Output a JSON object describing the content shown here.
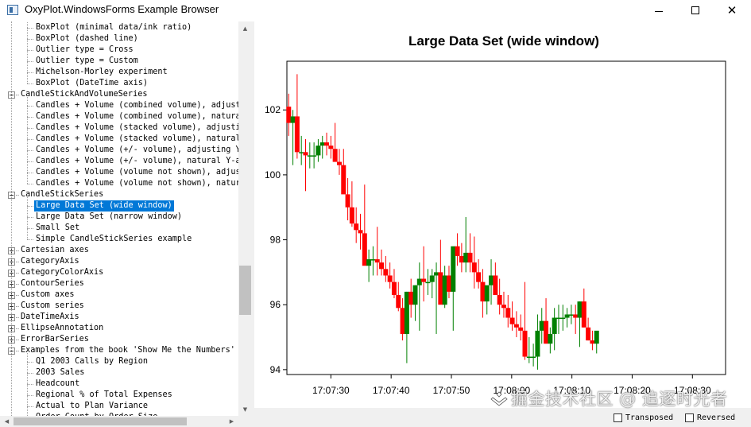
{
  "window": {
    "title": "OxyPlot.WindowsForms Example Browser",
    "minimize_glyph": "",
    "maximize_glyph": "",
    "close_glyph": "✕"
  },
  "tree": {
    "items": [
      {
        "label": "BoxPlot (minimal data/ink ratio)",
        "level": 1,
        "type": "leaf"
      },
      {
        "label": "BoxPlot (dashed line)",
        "level": 1,
        "type": "leaf"
      },
      {
        "label": "Outlier type = Cross",
        "level": 1,
        "type": "leaf"
      },
      {
        "label": "Outlier type = Custom",
        "level": 1,
        "type": "leaf"
      },
      {
        "label": "Michelson-Morley experiment",
        "level": 1,
        "type": "leaf"
      },
      {
        "label": "BoxPlot (DateTime axis)",
        "level": 1,
        "type": "leaf"
      },
      {
        "label": "CandleStickAndVolumeSeries",
        "level": 0,
        "type": "expanded"
      },
      {
        "label": "Candles + Volume (combined volume), adjusting",
        "level": 1,
        "type": "leaf"
      },
      {
        "label": "Candles + Volume (combined volume), natural Y-",
        "level": 1,
        "type": "leaf"
      },
      {
        "label": "Candles + Volume (stacked volume), adjusting Y",
        "level": 1,
        "type": "leaf"
      },
      {
        "label": "Candles + Volume (stacked volume), natural Y-a",
        "level": 1,
        "type": "leaf"
      },
      {
        "label": "Candles + Volume (+/- volume), adjusting Y-axi",
        "level": 1,
        "type": "leaf"
      },
      {
        "label": "Candles + Volume (+/- volume), natural Y-axis",
        "level": 1,
        "type": "leaf"
      },
      {
        "label": "Candles + Volume (volume not shown), adjusting",
        "level": 1,
        "type": "leaf"
      },
      {
        "label": "Candles + Volume (volume not shown), natural Y",
        "level": 1,
        "type": "leaf"
      },
      {
        "label": "CandleStickSeries",
        "level": 0,
        "type": "expanded"
      },
      {
        "label": "Large Data Set (wide window)",
        "level": 1,
        "type": "leaf",
        "selected": true
      },
      {
        "label": "Large Data Set (narrow window)",
        "level": 1,
        "type": "leaf"
      },
      {
        "label": "Small Set",
        "level": 1,
        "type": "leaf"
      },
      {
        "label": "Simple CandleStickSeries example",
        "level": 1,
        "type": "leaf"
      },
      {
        "label": "Cartesian axes",
        "level": 0,
        "type": "collapsed"
      },
      {
        "label": "CategoryAxis",
        "level": 0,
        "type": "collapsed"
      },
      {
        "label": "CategoryColorAxis",
        "level": 0,
        "type": "collapsed"
      },
      {
        "label": "ContourSeries",
        "level": 0,
        "type": "collapsed"
      },
      {
        "label": "Custom axes",
        "level": 0,
        "type": "collapsed"
      },
      {
        "label": "Custom series",
        "level": 0,
        "type": "collapsed"
      },
      {
        "label": "DateTimeAxis",
        "level": 0,
        "type": "collapsed"
      },
      {
        "label": "EllipseAnnotation",
        "level": 0,
        "type": "collapsed"
      },
      {
        "label": "ErrorBarSeries",
        "level": 0,
        "type": "collapsed"
      },
      {
        "label": "Examples from the book 'Show Me the Numbers'",
        "level": 0,
        "type": "expanded"
      },
      {
        "label": "Q1 2003 Calls by Region",
        "level": 1,
        "type": "leaf"
      },
      {
        "label": "2003 Sales",
        "level": 1,
        "type": "leaf"
      },
      {
        "label": "Headcount",
        "level": 1,
        "type": "leaf"
      },
      {
        "label": "Regional % of Total Expenses",
        "level": 1,
        "type": "leaf"
      },
      {
        "label": "Actual to Plan Variance",
        "level": 1,
        "type": "leaf"
      },
      {
        "label": "Order Count by Order Size",
        "level": 1,
        "type": "leaf"
      }
    ]
  },
  "options": {
    "transposed_label": "Transposed",
    "reversed_label": "Reversed",
    "transposed_checked": false,
    "reversed_checked": false
  },
  "watermark": {
    "text": "掘金技术社区 @ 追逐时光者"
  },
  "colors": {
    "increasing": "#008000",
    "decreasing": "#ff0000",
    "selection": "#0078d7"
  },
  "chart_data": {
    "type": "candlestick",
    "title": "Large Data Set (wide window)",
    "xlabel": "",
    "ylabel": "",
    "ylim": [
      93.85,
      103.5
    ],
    "xlim": [
      "17:07:22.7",
      "17:08:35.5"
    ],
    "y_ticks": [
      94,
      96,
      98,
      100,
      102
    ],
    "y_tick_labels": [
      "94",
      "96",
      "98",
      "100",
      "102"
    ],
    "x_ticks": [
      "17:07:30",
      "17:07:40",
      "17:07:50",
      "17:08:00",
      "17:08:10",
      "17:08:20",
      "17:08:30"
    ],
    "x_tick_labels": [
      "17:07:30",
      "17:07:40",
      "17:07:50",
      "17:08:00",
      "17:08:10",
      "17:08:20",
      "17:08:30"
    ],
    "grid": false,
    "legend": "none",
    "candles": [
      {
        "t": "17:07:23.0",
        "open": 102.1,
        "high": 102.5,
        "low": 101.2,
        "close": 101.6
      },
      {
        "t": "17:07:23.7",
        "open": 101.6,
        "high": 102.0,
        "low": 100.3,
        "close": 101.8
      },
      {
        "t": "17:07:24.4",
        "open": 101.8,
        "high": 103.1,
        "low": 100.5,
        "close": 100.7
      },
      {
        "t": "17:07:25.1",
        "open": 100.7,
        "high": 101.2,
        "low": 100.3,
        "close": 100.7
      },
      {
        "t": "17:07:25.8",
        "open": 100.7,
        "high": 101.1,
        "low": 99.5,
        "close": 100.6
      },
      {
        "t": "17:07:26.5",
        "open": 100.6,
        "high": 101.0,
        "low": 100.2,
        "close": 100.6
      },
      {
        "t": "17:07:27.2",
        "open": 100.6,
        "high": 101.0,
        "low": 100.2,
        "close": 100.6
      },
      {
        "t": "17:07:27.9",
        "open": 100.6,
        "high": 101.1,
        "low": 100.4,
        "close": 100.9
      },
      {
        "t": "17:07:28.6",
        "open": 100.9,
        "high": 101.2,
        "low": 100.5,
        "close": 101.0
      },
      {
        "t": "17:07:29.3",
        "open": 101.0,
        "high": 101.3,
        "low": 100.6,
        "close": 100.9
      },
      {
        "t": "17:07:30.0",
        "open": 100.9,
        "high": 101.2,
        "low": 100.5,
        "close": 100.8
      },
      {
        "t": "17:07:30.7",
        "open": 100.8,
        "high": 101.6,
        "low": 100.4,
        "close": 100.4
      },
      {
        "t": "17:07:31.4",
        "open": 100.4,
        "high": 100.8,
        "low": 100.0,
        "close": 100.3
      },
      {
        "t": "17:07:32.1",
        "open": 100.3,
        "high": 100.8,
        "low": 99.6,
        "close": 99.4
      },
      {
        "t": "17:07:32.8",
        "open": 99.4,
        "high": 99.9,
        "low": 98.6,
        "close": 99.0
      },
      {
        "t": "17:07:33.5",
        "open": 99.0,
        "high": 99.8,
        "low": 98.4,
        "close": 98.5
      },
      {
        "t": "17:07:34.2",
        "open": 98.5,
        "high": 99.0,
        "low": 97.9,
        "close": 98.3
      },
      {
        "t": "17:07:34.9",
        "open": 98.3,
        "high": 98.8,
        "low": 97.7,
        "close": 98.2
      },
      {
        "t": "17:07:35.6",
        "open": 98.2,
        "high": 99.7,
        "low": 97.4,
        "close": 97.2
      },
      {
        "t": "17:07:36.3",
        "open": 97.2,
        "high": 97.7,
        "low": 96.7,
        "close": 97.4
      },
      {
        "t": "17:07:37.0",
        "open": 97.4,
        "high": 97.8,
        "low": 96.9,
        "close": 97.4
      },
      {
        "t": "17:07:37.7",
        "open": 97.4,
        "high": 98.4,
        "low": 96.9,
        "close": 97.3
      },
      {
        "t": "17:07:38.4",
        "open": 97.3,
        "high": 97.7,
        "low": 96.9,
        "close": 97.1
      },
      {
        "t": "17:07:39.1",
        "open": 97.1,
        "high": 97.5,
        "low": 96.7,
        "close": 96.9
      },
      {
        "t": "17:07:39.8",
        "open": 96.9,
        "high": 97.3,
        "low": 96.5,
        "close": 96.7
      },
      {
        "t": "17:07:40.5",
        "open": 96.7,
        "high": 97.1,
        "low": 96.2,
        "close": 96.3
      },
      {
        "t": "17:07:41.2",
        "open": 96.3,
        "high": 96.7,
        "low": 95.8,
        "close": 95.9
      },
      {
        "t": "17:07:41.9",
        "open": 95.9,
        "high": 96.2,
        "low": 94.9,
        "close": 95.1
      },
      {
        "t": "17:07:42.6",
        "open": 95.1,
        "high": 96.4,
        "low": 94.2,
        "close": 96.4
      },
      {
        "t": "17:07:43.3",
        "open": 96.4,
        "high": 96.8,
        "low": 95.6,
        "close": 96.0
      },
      {
        "t": "17:07:44.0",
        "open": 96.0,
        "high": 96.6,
        "low": 95.5,
        "close": 96.6
      },
      {
        "t": "17:07:44.7",
        "open": 96.6,
        "high": 97.3,
        "low": 95.2,
        "close": 96.8
      },
      {
        "t": "17:07:45.4",
        "open": 96.8,
        "high": 97.8,
        "low": 96.1,
        "close": 96.7
      },
      {
        "t": "17:07:46.1",
        "open": 96.7,
        "high": 97.1,
        "low": 96.3,
        "close": 96.7
      },
      {
        "t": "17:07:46.8",
        "open": 96.7,
        "high": 97.1,
        "low": 96.2,
        "close": 96.9
      },
      {
        "t": "17:07:47.5",
        "open": 96.9,
        "high": 97.3,
        "low": 95.1,
        "close": 97.0
      },
      {
        "t": "17:07:48.2",
        "open": 97.0,
        "high": 98.0,
        "low": 96.6,
        "close": 96.0
      },
      {
        "t": "17:07:48.9",
        "open": 96.0,
        "high": 97.2,
        "low": 95.9,
        "close": 96.9
      },
      {
        "t": "17:07:49.6",
        "open": 96.9,
        "high": 97.2,
        "low": 96.2,
        "close": 96.4
      },
      {
        "t": "17:07:50.3",
        "open": 96.4,
        "high": 96.8,
        "low": 95.2,
        "close": 97.8
      },
      {
        "t": "17:07:51.0",
        "open": 97.8,
        "high": 98.2,
        "low": 97.2,
        "close": 97.5
      },
      {
        "t": "17:07:51.7",
        "open": 97.5,
        "high": 97.9,
        "low": 97.0,
        "close": 97.3
      },
      {
        "t": "17:07:52.4",
        "open": 97.3,
        "high": 98.7,
        "low": 97.0,
        "close": 97.6
      },
      {
        "t": "17:07:53.1",
        "open": 97.6,
        "high": 98.2,
        "low": 97.0,
        "close": 97.3
      },
      {
        "t": "17:07:53.8",
        "open": 97.3,
        "high": 98.1,
        "low": 96.5,
        "close": 97.0
      },
      {
        "t": "17:07:54.5",
        "open": 97.0,
        "high": 97.4,
        "low": 96.5,
        "close": 96.7
      },
      {
        "t": "17:07:55.2",
        "open": 96.7,
        "high": 97.1,
        "low": 95.6,
        "close": 96.1
      },
      {
        "t": "17:07:55.9",
        "open": 96.1,
        "high": 96.5,
        "low": 95.7,
        "close": 96.6
      },
      {
        "t": "17:07:56.6",
        "open": 96.6,
        "high": 97.4,
        "low": 96.0,
        "close": 96.9
      },
      {
        "t": "17:07:57.3",
        "open": 96.9,
        "high": 97.3,
        "low": 96.4,
        "close": 96.3
      },
      {
        "t": "17:07:58.0",
        "open": 96.3,
        "high": 96.8,
        "low": 95.7,
        "close": 96.0
      },
      {
        "t": "17:07:58.7",
        "open": 96.0,
        "high": 96.4,
        "low": 95.6,
        "close": 95.9
      },
      {
        "t": "17:07:59.4",
        "open": 95.9,
        "high": 96.3,
        "low": 95.3,
        "close": 95.6
      },
      {
        "t": "17:08:00.1",
        "open": 95.6,
        "high": 96.1,
        "low": 95.2,
        "close": 95.4
      },
      {
        "t": "17:08:00.8",
        "open": 95.4,
        "high": 95.8,
        "low": 95.0,
        "close": 95.3
      },
      {
        "t": "17:08:01.5",
        "open": 95.3,
        "high": 95.7,
        "low": 94.9,
        "close": 95.2
      },
      {
        "t": "17:08:02.2",
        "open": 95.2,
        "high": 96.7,
        "low": 94.3,
        "close": 94.4
      },
      {
        "t": "17:08:02.9",
        "open": 94.4,
        "high": 95.0,
        "low": 94.2,
        "close": 94.4
      },
      {
        "t": "17:08:03.6",
        "open": 94.4,
        "high": 94.8,
        "low": 94.1,
        "close": 94.4
      },
      {
        "t": "17:08:04.3",
        "open": 94.4,
        "high": 95.7,
        "low": 94.0,
        "close": 95.2
      },
      {
        "t": "17:08:05.0",
        "open": 95.2,
        "high": 95.9,
        "low": 94.8,
        "close": 95.5
      },
      {
        "t": "17:08:05.7",
        "open": 95.5,
        "high": 96.2,
        "low": 94.8,
        "close": 94.8
      },
      {
        "t": "17:08:06.4",
        "open": 94.8,
        "high": 95.3,
        "low": 94.5,
        "close": 95.1
      },
      {
        "t": "17:08:07.1",
        "open": 95.1,
        "high": 95.9,
        "low": 94.6,
        "close": 95.6
      },
      {
        "t": "17:08:07.8",
        "open": 95.6,
        "high": 96.0,
        "low": 95.1,
        "close": 95.6
      },
      {
        "t": "17:08:08.5",
        "open": 95.6,
        "high": 96.0,
        "low": 95.2,
        "close": 95.6
      },
      {
        "t": "17:08:09.2",
        "open": 95.6,
        "high": 95.9,
        "low": 95.3,
        "close": 95.7
      },
      {
        "t": "17:08:09.9",
        "open": 95.7,
        "high": 96.0,
        "low": 95.4,
        "close": 95.7
      },
      {
        "t": "17:08:10.6",
        "open": 95.7,
        "high": 96.0,
        "low": 95.1,
        "close": 95.6
      },
      {
        "t": "17:08:11.3",
        "open": 95.6,
        "high": 96.1,
        "low": 94.7,
        "close": 96.1
      },
      {
        "t": "17:08:12.0",
        "open": 96.1,
        "high": 96.5,
        "low": 95.3,
        "close": 95.3
      },
      {
        "t": "17:08:12.7",
        "open": 95.3,
        "high": 95.6,
        "low": 94.9,
        "close": 94.9
      },
      {
        "t": "17:08:13.4",
        "open": 94.9,
        "high": 95.2,
        "low": 94.6,
        "close": 94.8
      },
      {
        "t": "17:08:14.1",
        "open": 94.8,
        "high": 95.0,
        "low": 94.5,
        "close": 95.2
      }
    ]
  }
}
